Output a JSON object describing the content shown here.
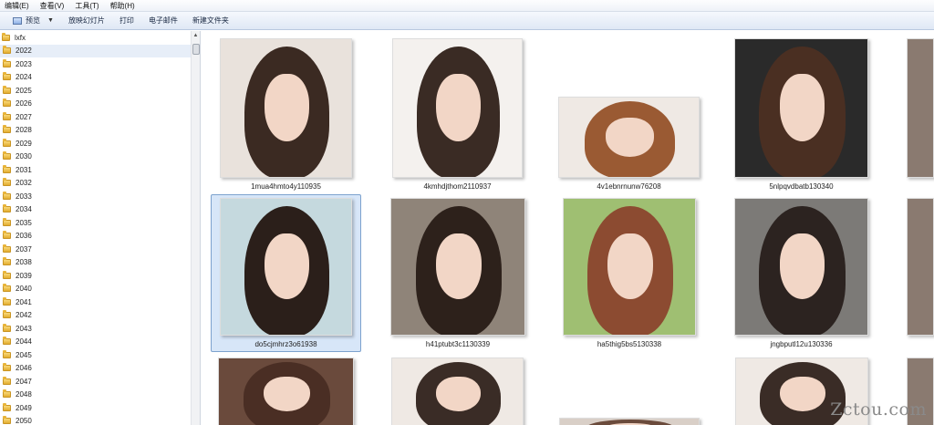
{
  "menubar": {
    "items": [
      "编辑(E)",
      "查看(V)",
      "工具(T)",
      "帮助(H)"
    ]
  },
  "toolbar": {
    "preview_label": "预览",
    "slideshow_label": "放映幻灯片",
    "print_label": "打印",
    "email_label": "电子邮件",
    "new_folder_label": "新建文件夹"
  },
  "tree": {
    "root_label": "lxfx",
    "folders": [
      "2022",
      "2023",
      "2024",
      "2025",
      "2026",
      "2027",
      "2028",
      "2029",
      "2030",
      "2031",
      "2032",
      "2033",
      "2034",
      "2035",
      "2036",
      "2037",
      "2038",
      "2039",
      "2040",
      "2041",
      "2042",
      "2043",
      "2044",
      "2045",
      "2046",
      "2047",
      "2048",
      "2049",
      "2050"
    ],
    "selected_folder": "2022"
  },
  "thumbnails": [
    {
      "name": "1mua4hmto4y110935",
      "selected": false
    },
    {
      "name": "4kmhdjthom2110937",
      "selected": false
    },
    {
      "name": "4v1ebnrnunw76208",
      "selected": false
    },
    {
      "name": "5nlpqvdbatb130340",
      "selected": false
    },
    {
      "name": "do5cjmhrz3o61938",
      "selected": true
    },
    {
      "name": "h41ptubt3c1130339",
      "selected": false
    },
    {
      "name": "ha5thig5bs5130338",
      "selected": false
    },
    {
      "name": "jngbputl12u130336",
      "selected": false
    },
    {
      "name": "",
      "selected": false
    },
    {
      "name": "",
      "selected": false
    },
    {
      "name": "",
      "selected": false
    },
    {
      "name": "",
      "selected": false
    }
  ],
  "watermark": "Zctou.com",
  "colors": {
    "selection": "#d7e6f8",
    "selection_border": "#7da2ce",
    "folder": "#e8b43a"
  }
}
